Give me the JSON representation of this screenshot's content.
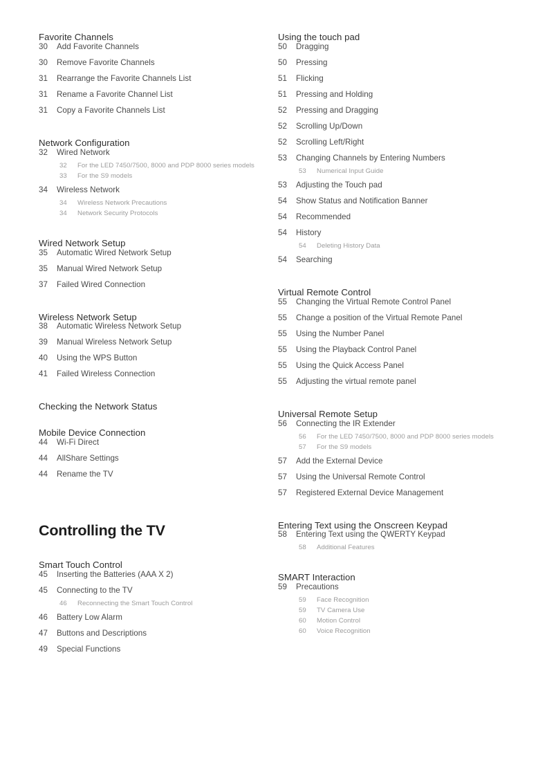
{
  "document": {
    "type": "table-of-contents",
    "page_background": "#ffffff",
    "text_color": "#4a4a4a",
    "subentry_color": "#9b9b9b"
  },
  "left_column": [
    {
      "kind": "section",
      "heading": "Favorite Channels",
      "entries": [
        {
          "page": "30",
          "title": "Add Favorite Channels"
        },
        {
          "page": "30",
          "title": "Remove Favorite Channels"
        },
        {
          "page": "31",
          "title": "Rearrange the Favorite Channels List"
        },
        {
          "page": "31",
          "title": "Rename a Favorite Channel List"
        },
        {
          "page": "31",
          "title": "Copy a Favorite Channels List"
        }
      ]
    },
    {
      "kind": "section",
      "heading": "Network Configuration",
      "entries": [
        {
          "page": "32",
          "title": "Wired Network",
          "subentries": [
            {
              "page": "32",
              "title": "For the LED 7450/7500, 8000 and PDP 8000 series models"
            },
            {
              "page": "33",
              "title": "For the S9 models"
            }
          ]
        },
        {
          "page": "34",
          "title": "Wireless Network",
          "subentries": [
            {
              "page": "34",
              "title": "Wireless Network Precautions"
            },
            {
              "page": "34",
              "title": "Network Security Protocols"
            }
          ]
        }
      ]
    },
    {
      "kind": "section",
      "heading": "Wired Network Setup",
      "entries": [
        {
          "page": "35",
          "title": "Automatic Wired Network Setup"
        },
        {
          "page": "35",
          "title": "Manual Wired Network Setup"
        },
        {
          "page": "37",
          "title": "Failed Wired Connection"
        }
      ]
    },
    {
      "kind": "section",
      "heading": "Wireless Network Setup",
      "entries": [
        {
          "page": "38",
          "title": "Automatic Wireless Network Setup"
        },
        {
          "page": "39",
          "title": "Manual Wireless Network Setup"
        },
        {
          "page": "40",
          "title": "Using the WPS Button"
        },
        {
          "page": "41",
          "title": "Failed Wireless Connection"
        }
      ]
    },
    {
      "kind": "section",
      "heading": "Checking the Network Status",
      "entries": []
    },
    {
      "kind": "section",
      "heading": "Mobile Device Connection",
      "entries": [
        {
          "page": "44",
          "title": "Wi-Fi Direct"
        },
        {
          "page": "44",
          "title": "AllShare Settings"
        },
        {
          "page": "44",
          "title": "Rename the TV"
        }
      ]
    },
    {
      "kind": "chapter",
      "heading": "Controlling the TV"
    },
    {
      "kind": "section",
      "heading": "Smart Touch Control",
      "entries": [
        {
          "page": "45",
          "title": "Inserting the Batteries (AAA X 2)"
        },
        {
          "page": "45",
          "title": "Connecting to the TV",
          "subentries": [
            {
              "page": "46",
              "title": "Reconnecting the Smart Touch Control"
            }
          ]
        },
        {
          "page": "46",
          "title": "Battery Low Alarm"
        },
        {
          "page": "47",
          "title": "Buttons and Descriptions"
        },
        {
          "page": "49",
          "title": "Special Functions"
        }
      ]
    }
  ],
  "right_column": [
    {
      "kind": "section",
      "heading": "Using the touch pad",
      "entries": [
        {
          "page": "50",
          "title": "Dragging"
        },
        {
          "page": "50",
          "title": "Pressing"
        },
        {
          "page": "51",
          "title": "Flicking"
        },
        {
          "page": "51",
          "title": "Pressing and Holding"
        },
        {
          "page": "52",
          "title": "Pressing and Dragging"
        },
        {
          "page": "52",
          "title": "Scrolling Up/Down"
        },
        {
          "page": "52",
          "title": "Scrolling Left/Right"
        },
        {
          "page": "53",
          "title": "Changing Channels by Entering Numbers",
          "subentries": [
            {
              "page": "53",
              "title": "Numerical Input Guide"
            }
          ]
        },
        {
          "page": "53",
          "title": "Adjusting the Touch pad"
        },
        {
          "page": "54",
          "title": "Show Status and Notification Banner"
        },
        {
          "page": "54",
          "title": "Recommended"
        },
        {
          "page": "54",
          "title": "History",
          "subentries": [
            {
              "page": "54",
              "title": "Deleting History Data"
            }
          ]
        },
        {
          "page": "54",
          "title": "Searching"
        }
      ]
    },
    {
      "kind": "section",
      "heading": "Virtual Remote Control",
      "entries": [
        {
          "page": "55",
          "title": "Changing the Virtual Remote Control Panel"
        },
        {
          "page": "55",
          "title": "Change a position of the Virtual Remote Panel"
        },
        {
          "page": "55",
          "title": "Using the Number Panel"
        },
        {
          "page": "55",
          "title": "Using the Playback Control Panel"
        },
        {
          "page": "55",
          "title": "Using the Quick Access Panel"
        },
        {
          "page": "55",
          "title": "Adjusting the virtual remote panel"
        }
      ]
    },
    {
      "kind": "section",
      "heading": "Universal Remote Setup",
      "entries": [
        {
          "page": "56",
          "title": "Connecting the IR Extender",
          "subentries": [
            {
              "page": "56",
              "title": "For the LED 7450/7500, 8000 and PDP 8000 series models"
            },
            {
              "page": "57",
              "title": "For the S9 models"
            }
          ]
        },
        {
          "page": "57",
          "title": "Add the External Device"
        },
        {
          "page": "57",
          "title": "Using the Universal Remote Control"
        },
        {
          "page": "57",
          "title": "Registered External Device Management"
        }
      ]
    },
    {
      "kind": "section",
      "heading": "Entering Text using the Onscreen Keypad",
      "entries": [
        {
          "page": "58",
          "title": "Entering Text using the QWERTY Keypad",
          "subentries": [
            {
              "page": "58",
              "title": "Additional Features"
            }
          ]
        }
      ]
    },
    {
      "kind": "section",
      "heading": "SMART Interaction",
      "entries": [
        {
          "page": "59",
          "title": "Precautions",
          "subentries": [
            {
              "page": "59",
              "title": "Face Recognition"
            },
            {
              "page": "59",
              "title": "TV Camera Use"
            },
            {
              "page": "60",
              "title": "Motion Control"
            },
            {
              "page": "60",
              "title": "Voice Recognition"
            }
          ]
        }
      ]
    }
  ]
}
